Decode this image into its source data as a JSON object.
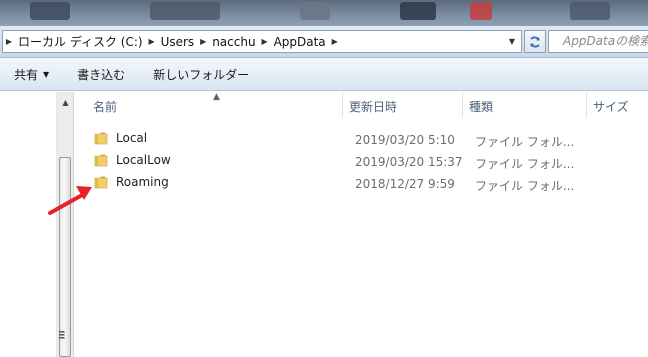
{
  "address_bar": {
    "crumbs": [
      "ローカル ディスク (C:)",
      "Users",
      "nacchu",
      "AppData"
    ],
    "search_placeholder": "AppDataの検索"
  },
  "command_bar": {
    "items": [
      "共有",
      "書き込む",
      "新しいフォルダー"
    ]
  },
  "columns": {
    "name": "名前",
    "date": "更新日時",
    "type": "種類",
    "size": "サイズ"
  },
  "files": [
    {
      "name": "Local",
      "date": "2019/03/20 5:10",
      "type": "ファイル フォル..."
    },
    {
      "name": "LocalLow",
      "date": "2019/03/20 15:37",
      "type": "ファイル フォル..."
    },
    {
      "name": "Roaming",
      "date": "2018/12/27 9:59",
      "type": "ファイル フォル..."
    }
  ],
  "colors": {
    "annotation_arrow": "#e8202a",
    "folder": "#e7c35a"
  }
}
